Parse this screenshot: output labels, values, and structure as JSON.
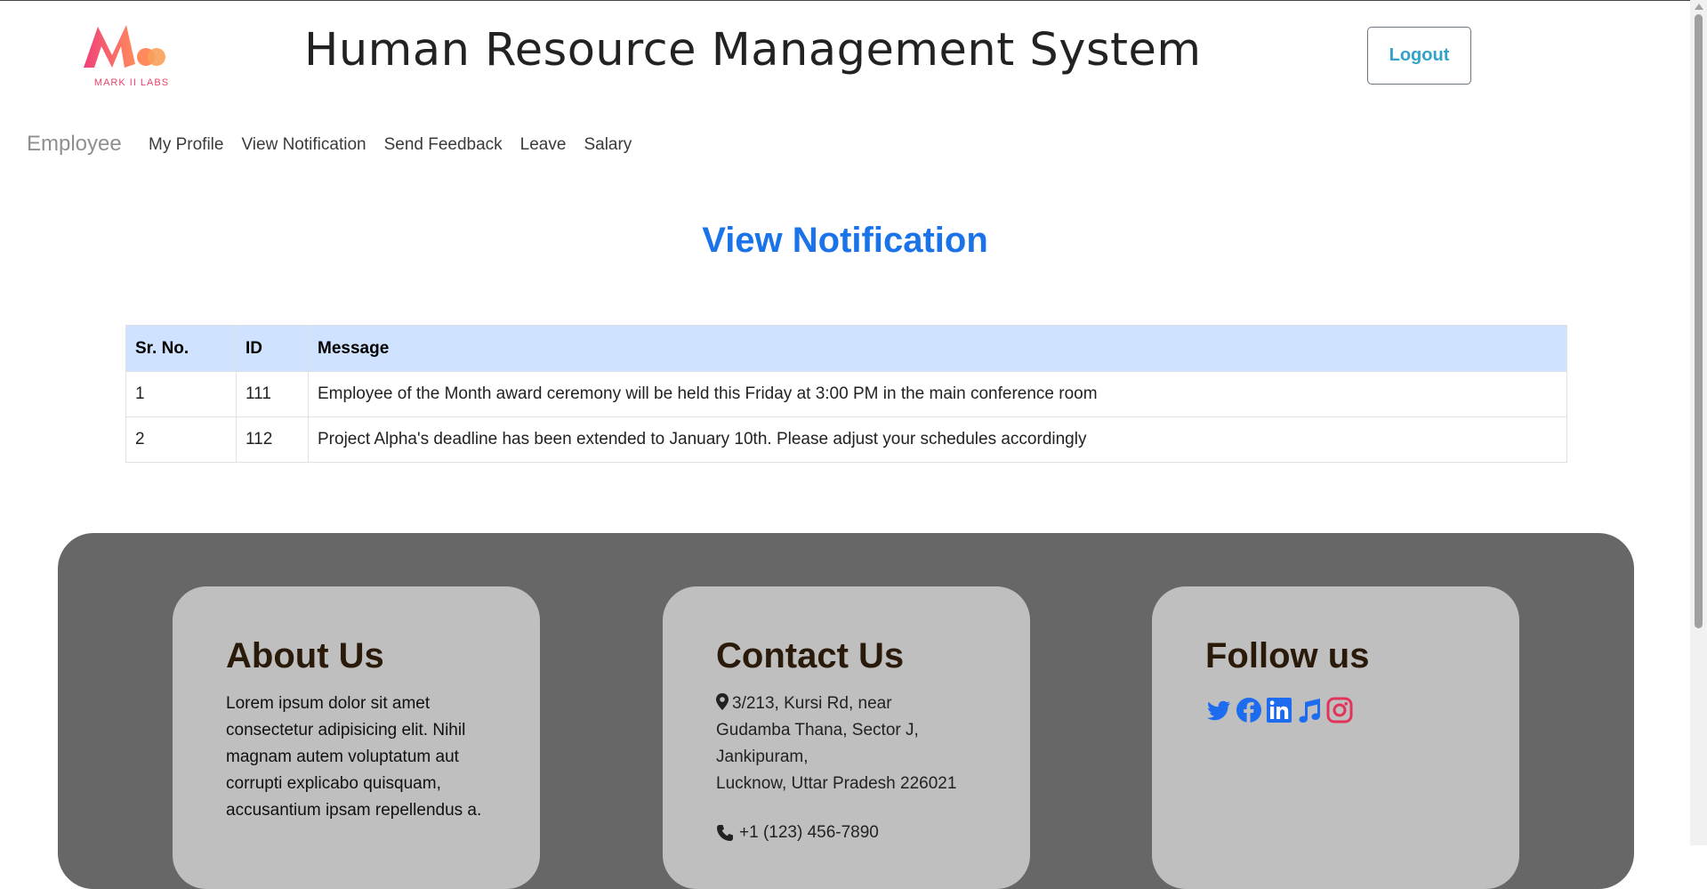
{
  "header": {
    "logo_text": "MARK II LABS",
    "title": "Human Resource Management System",
    "logout_label": "Logout"
  },
  "nav": {
    "brand": "Employee",
    "items": [
      {
        "label": "My Profile"
      },
      {
        "label": "View Notification"
      },
      {
        "label": "Send Feedback"
      },
      {
        "label": "Leave"
      },
      {
        "label": "Salary"
      }
    ]
  },
  "main": {
    "heading": "View Notification",
    "table": {
      "columns": [
        "Sr. No.",
        "ID",
        "Message"
      ],
      "rows": [
        {
          "sr": "1",
          "id": "111",
          "message": "Employee of the Month award ceremony will be held this Friday at 3:00 PM in the main conference room"
        },
        {
          "sr": "2",
          "id": "112",
          "message": "Project Alpha's deadline has been extended to January 10th. Please adjust your schedules accordingly"
        }
      ]
    }
  },
  "footer": {
    "about": {
      "title": "About Us",
      "text": "Lorem ipsum dolor sit amet consectetur adipisicing elit. Nihil magnam autem voluptatum aut corrupti explicabo quisquam, accusantium ipsam repellendus a."
    },
    "contact": {
      "title": "Contact Us",
      "address_lines": [
        "3/213, Kursi Rd, near",
        "Gudamba Thana, Sector J,",
        "Jankipuram,",
        "Lucknow, Uttar Pradesh 226021"
      ],
      "phone": "+1 (123) 456-7890"
    },
    "follow": {
      "title": "Follow us",
      "icons": [
        "twitter-icon",
        "facebook-icon",
        "linkedin-icon",
        "music-icon",
        "instagram-icon"
      ]
    }
  },
  "colors": {
    "accent": "#1a73e8",
    "logout_text": "#31a3c9",
    "table_header_bg": "#cfe2ff",
    "footer_bg": "#676767",
    "card_bg": "#bfbfbf"
  }
}
